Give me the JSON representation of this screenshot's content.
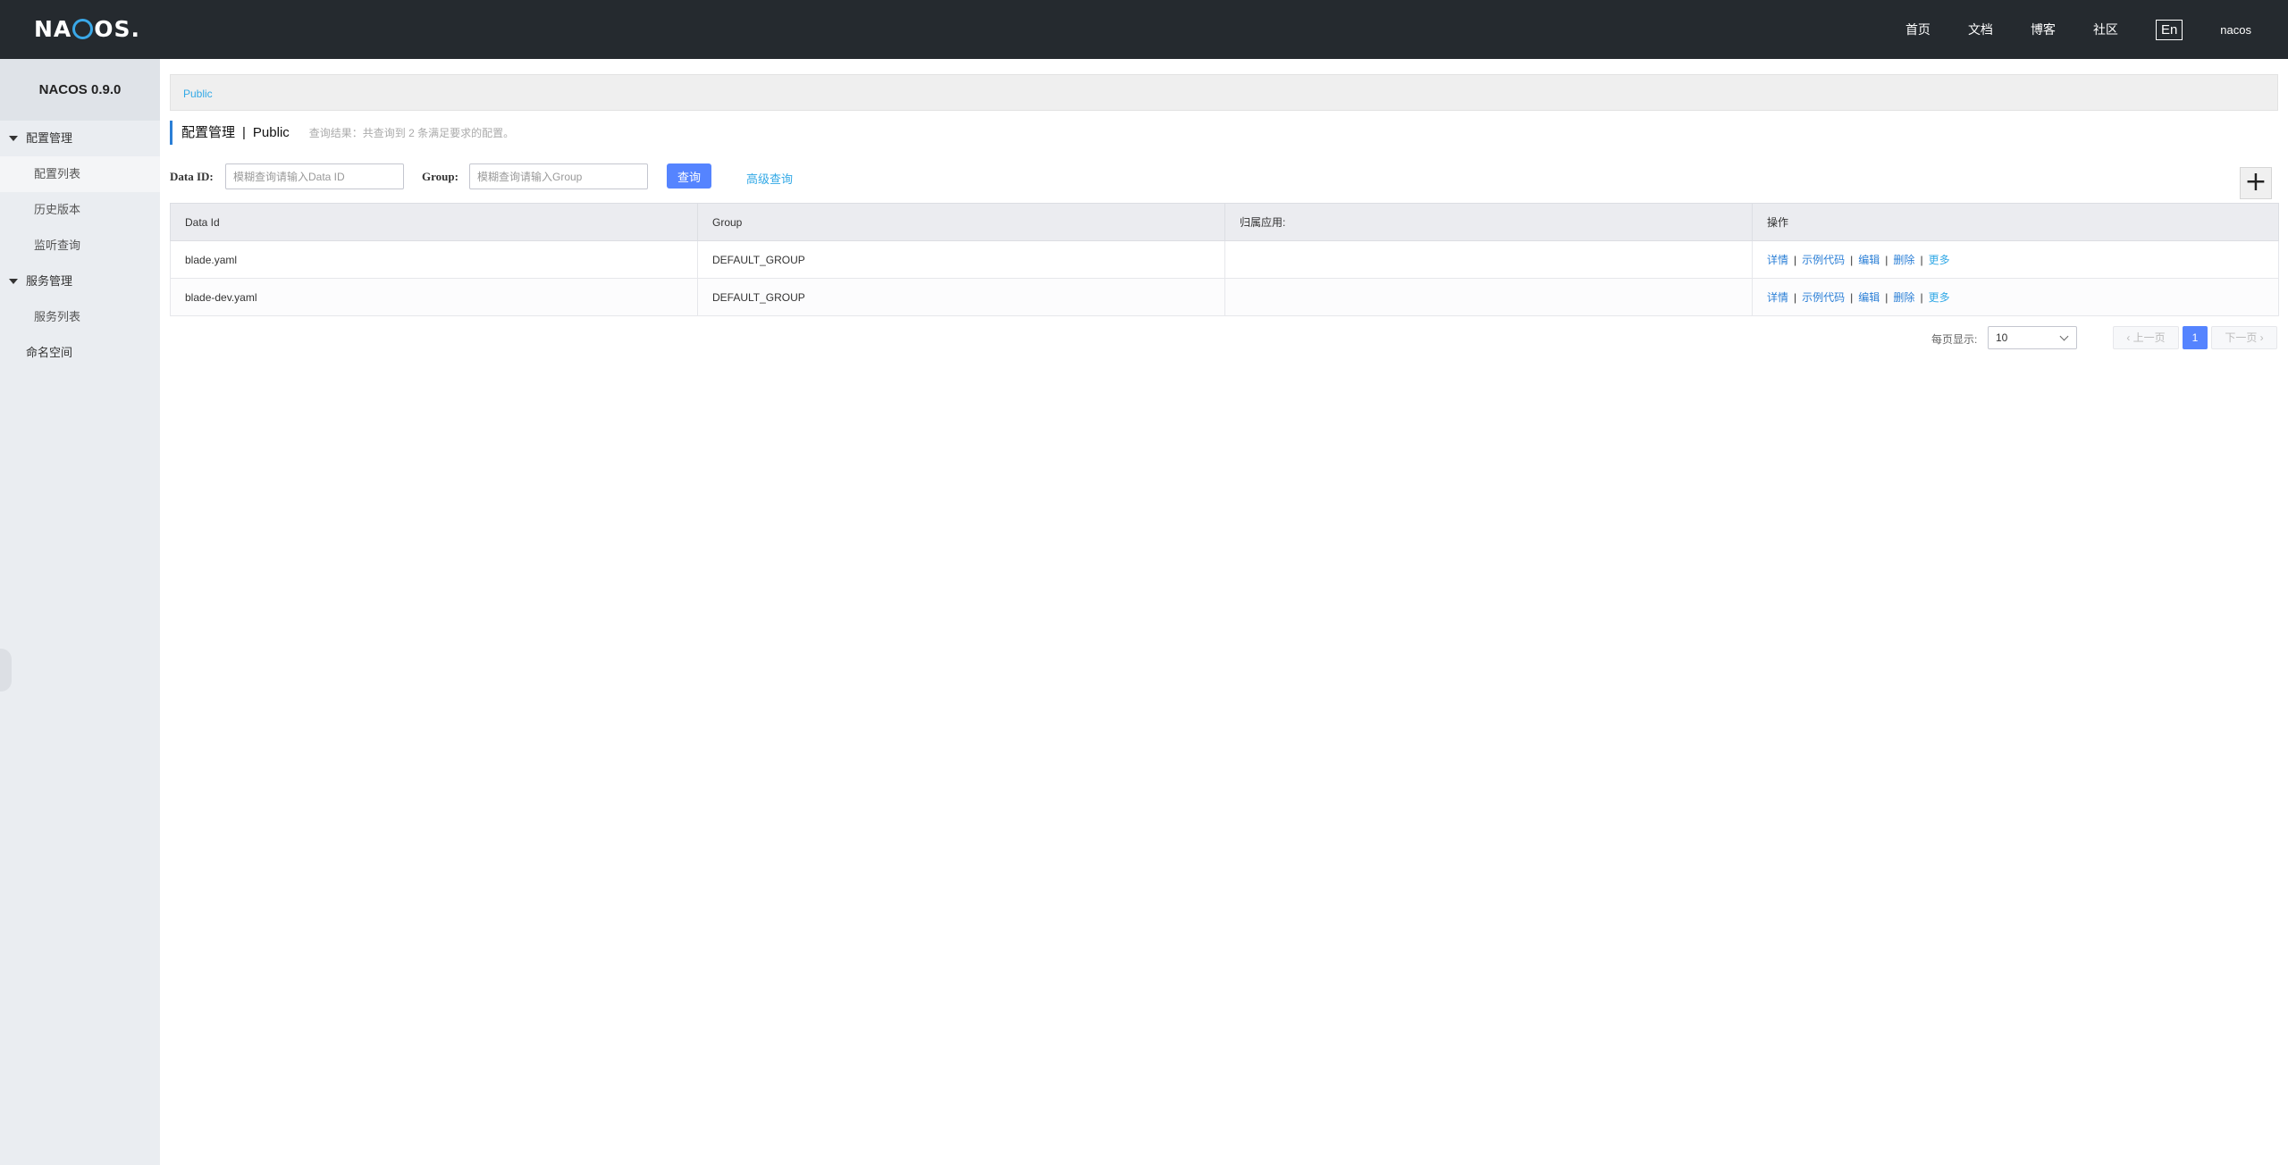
{
  "header": {
    "logo_left": "NA",
    "logo_right": "OS.",
    "nav": [
      "首页",
      "文档",
      "博客",
      "社区"
    ],
    "lang": "En",
    "user": "nacos"
  },
  "sidebar": {
    "title": "NACOS 0.9.0",
    "groups": [
      {
        "label": "配置管理",
        "items": [
          "配置列表",
          "历史版本",
          "监听查询"
        ]
      },
      {
        "label": "服务管理",
        "items": [
          "服务列表"
        ]
      }
    ],
    "namespace": "命名空间"
  },
  "main": {
    "namespace_tab": "Public",
    "title": "配置管理",
    "title_sep": "|",
    "title_ns": "Public",
    "summary": "查询结果：共查询到 2 条满足要求的配置。",
    "search": {
      "data_id_label": "Data ID:",
      "data_id_placeholder": "模糊查询请输入Data ID",
      "group_label": "Group:",
      "group_placeholder": "模糊查询请输入Group",
      "query_btn": "查询",
      "advanced": "高级查询",
      "add_btn": "+"
    },
    "table": {
      "headers": [
        "Data Id",
        "Group",
        "归属应用:",
        "操作"
      ],
      "rows": [
        {
          "data_id": "blade.yaml",
          "group": "DEFAULT_GROUP",
          "app": ""
        },
        {
          "data_id": "blade-dev.yaml",
          "group": "DEFAULT_GROUP",
          "app": ""
        }
      ],
      "ops": [
        "详情",
        "示例代码",
        "编辑",
        "删除",
        "更多"
      ],
      "op_sep": "|"
    },
    "pagination": {
      "page_size_label": "每页显示:",
      "page_size": "10",
      "prev": "上一页",
      "current": "1",
      "next": "下一页"
    }
  },
  "colors": {
    "header_bg": "#252a2f",
    "sidebar_bg": "#eaedf1",
    "primary": "#5584ff",
    "link": "#2b7fd6",
    "accent_link": "#33a9e6"
  }
}
